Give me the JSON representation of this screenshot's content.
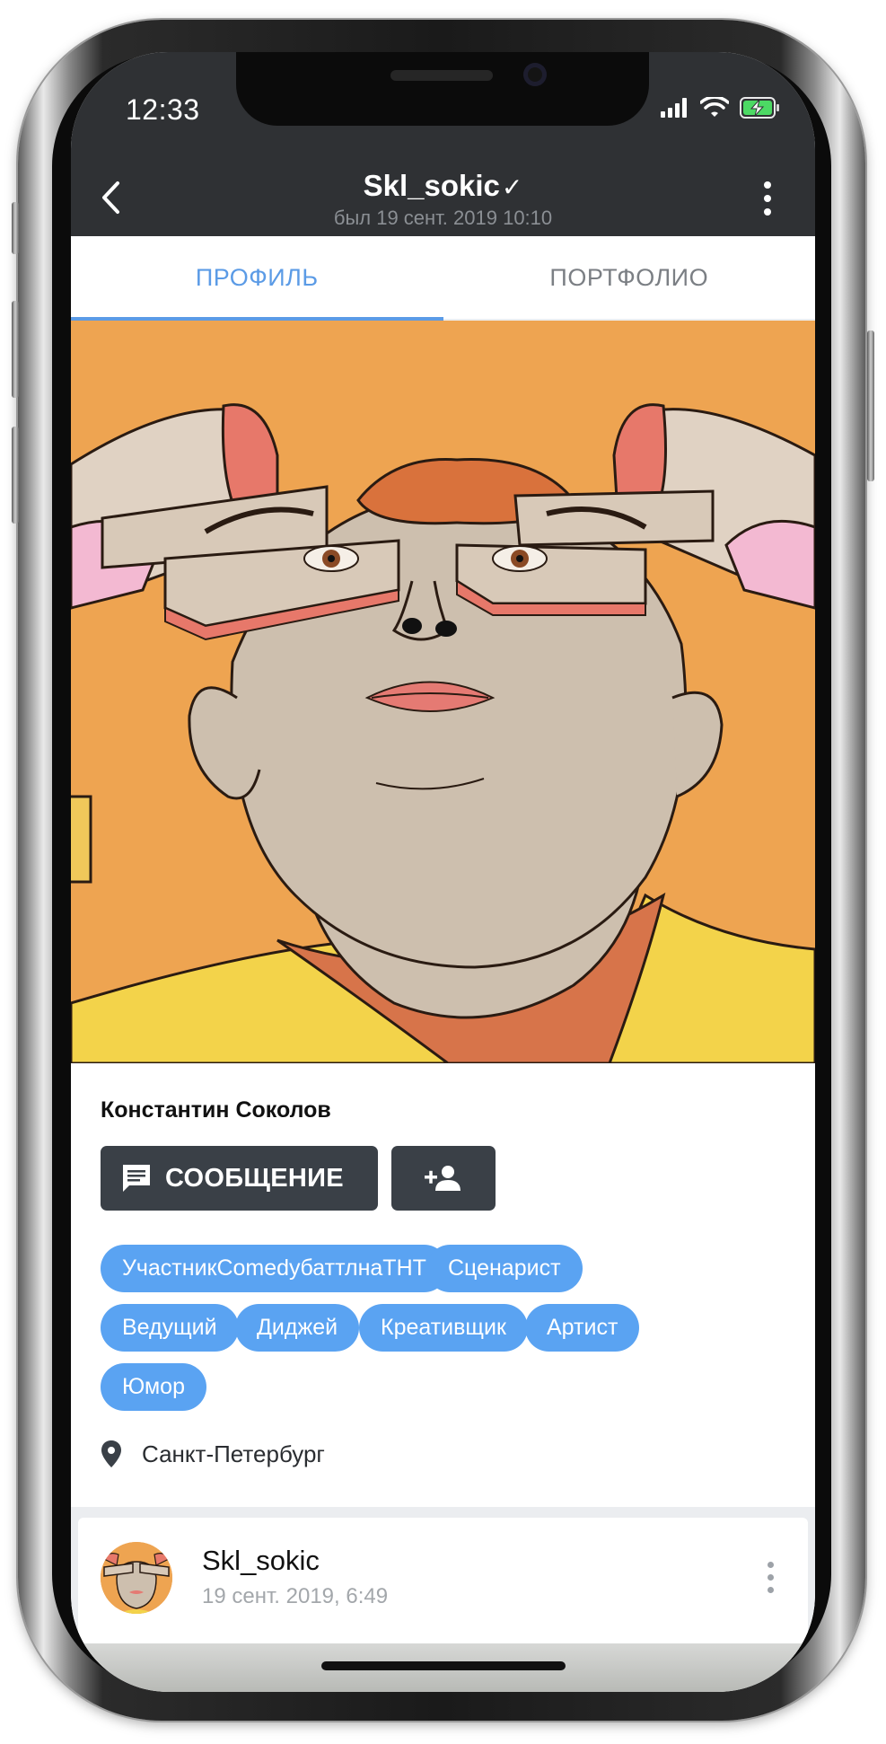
{
  "status_bar": {
    "time": "12:33"
  },
  "header": {
    "title": "Skl_sokic",
    "verified_mark": "✓",
    "subtitle": "был 19 сент. 2019 10:10",
    "icons": {
      "back": "chevron-left-icon",
      "menu": "more-vertical-icon"
    }
  },
  "tabs": [
    {
      "label": "ПРОФИЛЬ",
      "active": true
    },
    {
      "label": "ПОРТФОЛИО",
      "active": false
    }
  ],
  "profile": {
    "name": "Константин Соколов",
    "message_button_label": "СООБЩЕНИЕ",
    "tags": [
      "УчастникComedyбаттлнаТНТ",
      "Сценарист",
      "Ведущий",
      "Диджей",
      "Креативщик",
      "Артист",
      "Юмор"
    ],
    "location": "Санкт-Петербург"
  },
  "post": {
    "author": "Skl_sokic",
    "date": "19 сент. 2019, 6:49"
  },
  "colors": {
    "header_bg": "#2f3134",
    "accent": "#5b9be6",
    "tag_bg": "#5aa3f2",
    "button_bg": "#3a4047",
    "cover_bg": "#eea451"
  }
}
